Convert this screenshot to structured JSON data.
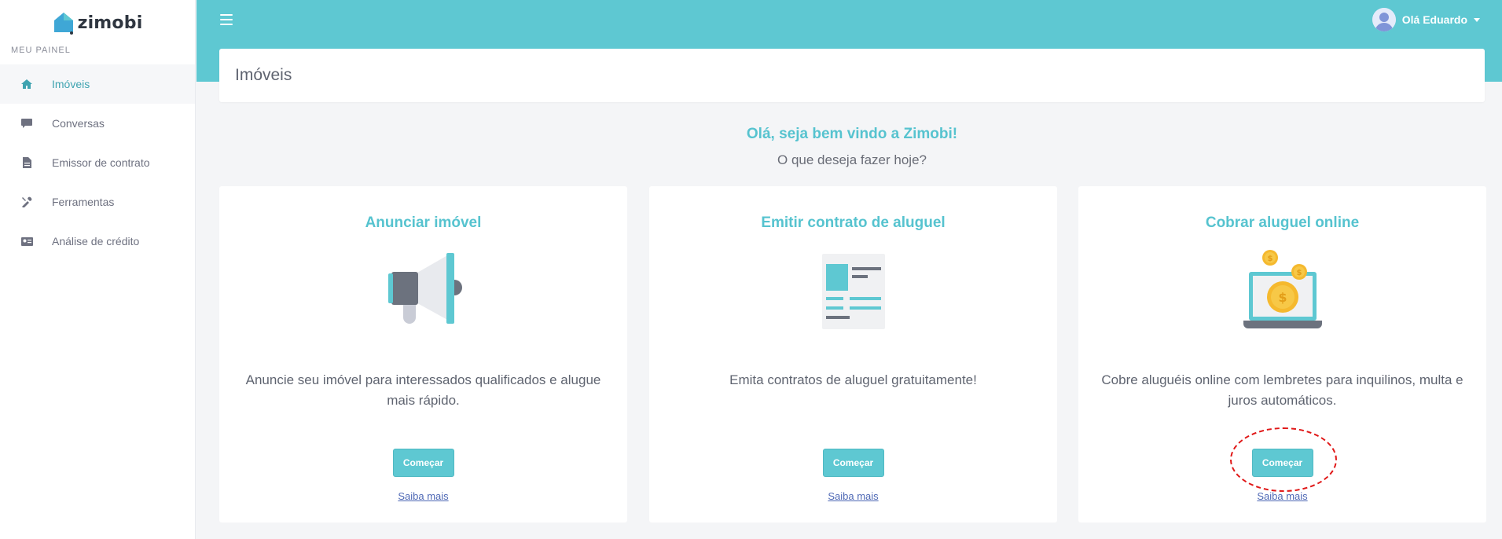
{
  "brand": {
    "name": "zimobi"
  },
  "sidebar": {
    "heading": "MEU PAINEL",
    "items": [
      {
        "label": "Imóveis",
        "icon": "home-icon",
        "active": true
      },
      {
        "label": "Conversas",
        "icon": "chat-icon"
      },
      {
        "label": "Emissor de contrato",
        "icon": "document-icon"
      },
      {
        "label": "Ferramentas",
        "icon": "tools-icon"
      },
      {
        "label": "Análise de crédito",
        "icon": "id-card-icon"
      }
    ]
  },
  "topbar": {
    "user_greeting": "Olá Eduardo"
  },
  "page": {
    "title": "Imóveis",
    "welcome_title": "Olá, seja bem vindo a Zimobi!",
    "welcome_subtitle": "O que deseja fazer hoje?"
  },
  "cards": [
    {
      "title": "Anunciar imóvel",
      "description": "Anuncie seu imóvel para interessados qualificados e alugue mais rápido.",
      "button": "Começar",
      "link": "Saiba mais",
      "icon": "megaphone-icon"
    },
    {
      "title": "Emitir contrato de aluguel",
      "description": "Emita contratos de aluguel gratuitamente!",
      "button": "Começar",
      "link": "Saiba mais",
      "icon": "contract-icon"
    },
    {
      "title": "Cobrar aluguel online",
      "description": "Cobre aluguéis online com lembretes para inquilinos, multa e juros automáticos.",
      "button": "Começar",
      "link": "Saiba mais",
      "icon": "laptop-coins-icon"
    }
  ],
  "colors": {
    "accent": "#5ec8d2",
    "accent_text": "#56c3cf",
    "highlight": "#e01818"
  }
}
